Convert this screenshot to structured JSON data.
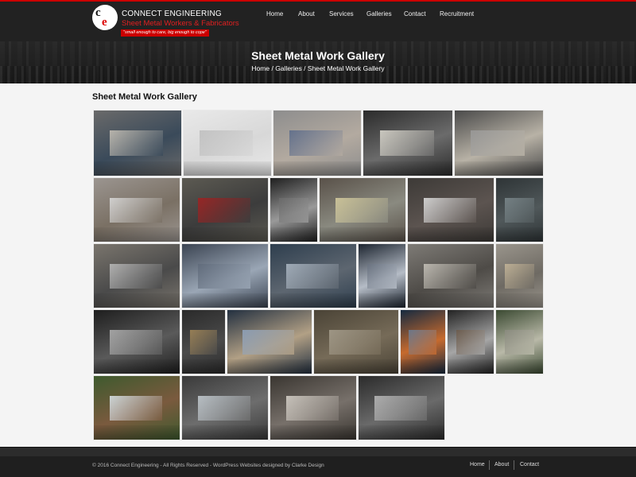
{
  "header": {
    "brand_name": "CONNECT ENGINEERING",
    "brand_sub": "Sheet Metal Workers & Fabricators",
    "brand_tagline": "\"small enough to care, big enough to cope\"",
    "accent_color": "#cc0000",
    "logo_icon": "ce-monogram-icon",
    "nav": [
      "Home",
      "About",
      "Services",
      "Galleries",
      "Contact",
      "Recruitment"
    ]
  },
  "banner": {
    "title": "Sheet Metal Work Gallery",
    "breadcrumb": [
      "Home",
      "Galleries",
      "Sheet Metal Work Gallery"
    ],
    "separator": "/"
  },
  "main": {
    "heading": "Sheet Metal Work Gallery"
  },
  "footer": {
    "copyright": "© 2016 Connect Engineering - All Rights Reserved - WordPress Websites designed by Clarke Design",
    "links": [
      "Home",
      "About",
      "Contact"
    ]
  }
}
